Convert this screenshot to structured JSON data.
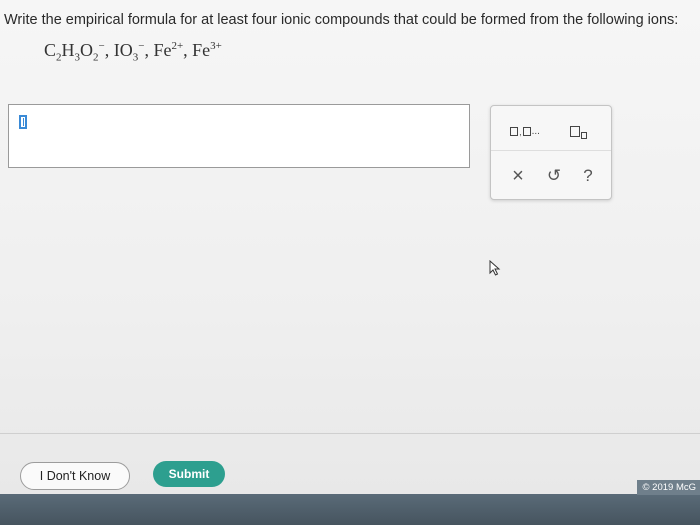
{
  "question": {
    "prompt": "Write the empirical formula for at least four ionic compounds that could be formed from the following ions:",
    "ions": [
      {
        "base1": "C",
        "sub1": "2",
        "base2": "H",
        "sub2": "3",
        "base3": "O",
        "sub3": "2",
        "charge": "−"
      },
      {
        "base": "IO",
        "sub": "3",
        "charge": "−"
      },
      {
        "base": "Fe",
        "charge": "2+"
      },
      {
        "base": "Fe",
        "charge": "3+"
      }
    ]
  },
  "toolbar": {
    "multi_label": "□,□,...",
    "subscript_label": "□□",
    "clear_label": "×",
    "undo_label": "↺",
    "help_label": "?"
  },
  "actions": {
    "dont_know_label": "I Don't Know",
    "submit_label": "Submit"
  },
  "footer": {
    "copyright": "© 2019 McG"
  }
}
